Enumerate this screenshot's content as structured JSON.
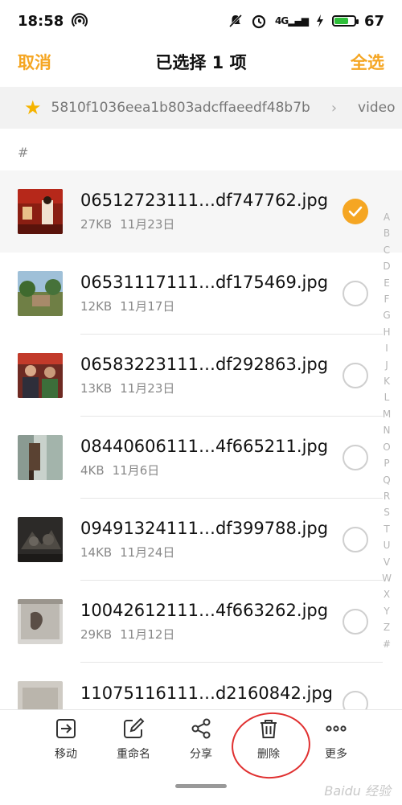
{
  "status_bar": {
    "time": "18:58",
    "network": "4G",
    "battery": "67"
  },
  "header": {
    "cancel_label": "取消",
    "title": "已选择 1 项",
    "select_all_label": "全选"
  },
  "breadcrumb": {
    "path_segment": "5810f1036eea1b803adcffaeedf48b7b",
    "current": "video"
  },
  "section_header": "#",
  "files": [
    {
      "name": "06512723111…df747762.jpg",
      "size": "27KB",
      "date": "11月23日",
      "selected": true
    },
    {
      "name": "06531117111…df175469.jpg",
      "size": "12KB",
      "date": "11月17日",
      "selected": false
    },
    {
      "name": "06583223111…df292863.jpg",
      "size": "13KB",
      "date": "11月23日",
      "selected": false
    },
    {
      "name": "08440606111…4f665211.jpg",
      "size": "4KB",
      "date": "11月6日",
      "selected": false
    },
    {
      "name": "09491324111…df399788.jpg",
      "size": "14KB",
      "date": "11月24日",
      "selected": false
    },
    {
      "name": "10042612111…4f663262.jpg",
      "size": "29KB",
      "date": "11月12日",
      "selected": false
    },
    {
      "name": "11075116111…d2160842.jpg",
      "size": "",
      "date": "",
      "selected": false
    }
  ],
  "alpha_index": [
    "A",
    "B",
    "C",
    "D",
    "E",
    "F",
    "G",
    "H",
    "I",
    "J",
    "K",
    "L",
    "M",
    "N",
    "O",
    "P",
    "Q",
    "R",
    "S",
    "T",
    "U",
    "V",
    "W",
    "X",
    "Y",
    "Z",
    "#"
  ],
  "toolbar": {
    "move_label": "移动",
    "rename_label": "重命名",
    "share_label": "分享",
    "delete_label": "删除",
    "more_label": "更多"
  },
  "watermark": "Baidu 经验",
  "colors": {
    "accent": "#f5a623",
    "annotation": "#e03030"
  }
}
